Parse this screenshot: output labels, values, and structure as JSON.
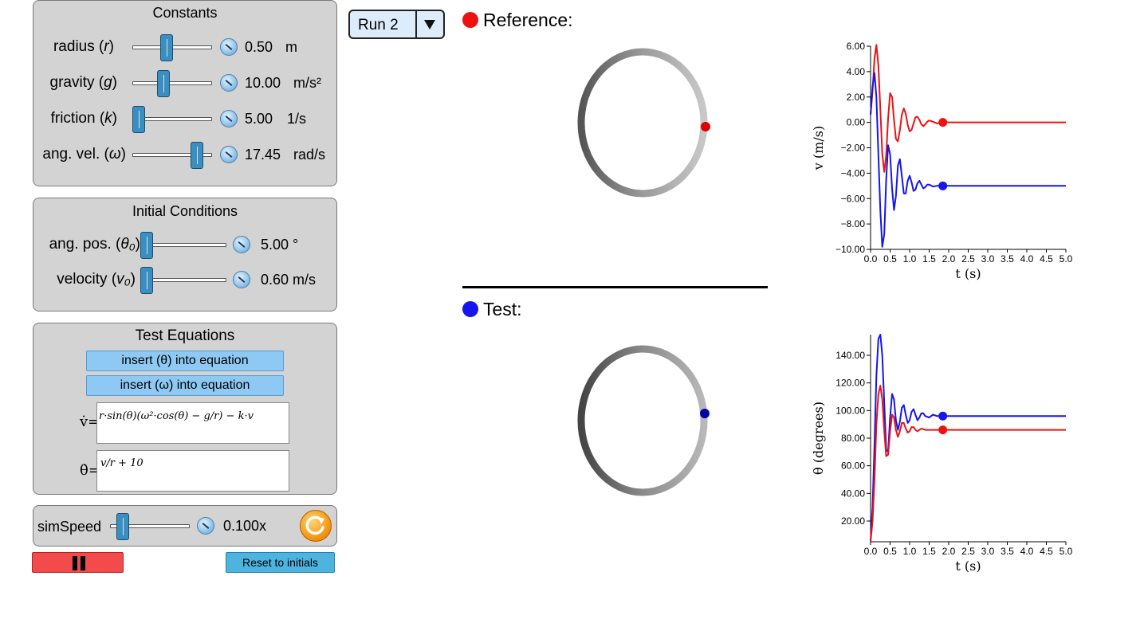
{
  "constants": {
    "title": "Constants",
    "rows": [
      {
        "label": "radius (",
        "sym": "r",
        "close": ")",
        "value": "0.50",
        "unit": "m",
        "level": 0.42
      },
      {
        "label": "gravity (",
        "sym": "g",
        "close": ")",
        "value": "10.00",
        "unit": "m/s²",
        "level": 0.37
      },
      {
        "label": "friction (",
        "sym": "k",
        "close": ")",
        "value": "5.00",
        "unit": "1/s",
        "level": 0.0
      },
      {
        "label": "ang. vel. (",
        "sym": "ω",
        "close": ")",
        "value": "17.45",
        "unit": "rad/s",
        "level": 0.87
      }
    ]
  },
  "initial": {
    "title": "Initial Conditions",
    "rows": [
      {
        "label": "ang. pos. (",
        "sym": "θ₀",
        "close": ")",
        "value": "5.00 °",
        "level": 0.0
      },
      {
        "label": "velocity (",
        "sym": "v₀",
        "close": ")",
        "value": "0.60 m/s",
        "level": 0.0
      }
    ]
  },
  "test_equations": {
    "title": "Test Equations",
    "insert_theta": "insert (θ) into equation",
    "insert_omega": "insert (ω) into equation",
    "vdot_label": "v̇=",
    "thetadot_label": "θ̇=",
    "vdot_eq": "r·sin(θ)(ω²·cos(θ) − g/r) − k·v",
    "thetadot_eq": "v/r + 10"
  },
  "sim": {
    "label": "simSpeed",
    "value": "0.100x",
    "level": 0.1,
    "reset_label": "Reset to initials",
    "pause_icon": "pause-icon",
    "refresh_icon": "refresh-icon"
  },
  "run_select": {
    "selected": "Run 2"
  },
  "reference": {
    "title": "Reference:",
    "color": "#ee1111"
  },
  "test": {
    "title": "Test:",
    "color": "#1515ee"
  },
  "chart_data": [
    {
      "type": "line",
      "xlabel": "t (s)",
      "ylabel": "v (m/s)",
      "xlim": [
        0,
        5
      ],
      "ylim": [
        -10,
        6
      ],
      "xticks": [
        "0.0",
        "0.5",
        "1.0",
        "1.5",
        "2.0",
        "2.5",
        "3.0",
        "3.5",
        "4.0",
        "4.5",
        "5.0"
      ],
      "yticks": [
        "6.00",
        "4.00",
        "2.00",
        "0.00",
        "−2.00",
        "−4.00",
        "−6.00",
        "−8.00",
        "−10.00"
      ],
      "series": [
        {
          "color": "#ee1111",
          "marker": {
            "x": 1.85,
            "y": 0.0
          },
          "x": [
            0,
            0.05,
            0.1,
            0.15,
            0.2,
            0.25,
            0.3,
            0.35,
            0.4,
            0.45,
            0.5,
            0.55,
            0.6,
            0.65,
            0.7,
            0.75,
            0.8,
            0.85,
            0.9,
            0.95,
            1.0,
            1.05,
            1.1,
            1.15,
            1.2,
            1.25,
            1.3,
            1.35,
            1.4,
            1.45,
            1.5,
            1.6,
            1.7,
            1.8,
            1.9,
            2.0,
            2.2,
            2.5,
            3.0,
            4.0,
            5.0
          ],
          "y": [
            0.6,
            2.5,
            5.0,
            6.1,
            4.5,
            1.0,
            -2.5,
            -3.9,
            -2.6,
            0.3,
            2.3,
            2.0,
            0.2,
            -1.3,
            -1.5,
            -0.6,
            0.6,
            1.1,
            0.7,
            -0.2,
            -0.7,
            -0.6,
            -0.1,
            0.4,
            0.45,
            0.2,
            -0.15,
            -0.3,
            -0.15,
            0.05,
            0.15,
            0.05,
            -0.08,
            -0.02,
            0.04,
            0.0,
            0.0,
            0.0,
            0.0,
            0.0,
            0.0
          ]
        },
        {
          "color": "#1515ee",
          "marker": {
            "x": 1.85,
            "y": -5.0
          },
          "x": [
            0,
            0.05,
            0.1,
            0.15,
            0.2,
            0.25,
            0.3,
            0.35,
            0.4,
            0.45,
            0.5,
            0.55,
            0.6,
            0.65,
            0.7,
            0.75,
            0.8,
            0.85,
            0.9,
            0.95,
            1.0,
            1.05,
            1.1,
            1.15,
            1.2,
            1.25,
            1.3,
            1.35,
            1.4,
            1.45,
            1.5,
            1.6,
            1.7,
            1.8,
            1.9,
            2.0,
            2.2,
            2.5,
            3.0,
            4.0,
            5.0
          ],
          "y": [
            0.6,
            2.8,
            3.9,
            2.0,
            -2.5,
            -7.0,
            -9.8,
            -8.8,
            -4.5,
            -1.8,
            -2.5,
            -5.2,
            -6.9,
            -5.8,
            -3.4,
            -2.9,
            -4.2,
            -5.6,
            -5.6,
            -4.6,
            -4.2,
            -4.7,
            -5.4,
            -5.3,
            -4.8,
            -4.6,
            -4.9,
            -5.2,
            -5.1,
            -4.9,
            -4.9,
            -5.05,
            -5.0,
            -4.97,
            -5.0,
            -5.0,
            -5.0,
            -5.0,
            -5.0,
            -5.0,
            -5.0
          ]
        }
      ]
    },
    {
      "type": "line",
      "xlabel": "t (s)",
      "ylabel": "θ (degrees)",
      "xlim": [
        0,
        5
      ],
      "ylim": [
        5,
        155
      ],
      "xticks": [
        "0.0",
        "0.5",
        "1.0",
        "1.5",
        "2.0",
        "2.5",
        "3.0",
        "3.5",
        "4.0",
        "4.5",
        "5.0"
      ],
      "yticks": [
        "140.00",
        "120.00",
        "100.00",
        "80.00",
        "60.00",
        "40.00",
        "20.00"
      ],
      "series": [
        {
          "color": "#1515ee",
          "marker": {
            "x": 1.85,
            "y": 96
          },
          "x": [
            0,
            0.05,
            0.1,
            0.15,
            0.2,
            0.25,
            0.3,
            0.35,
            0.4,
            0.45,
            0.5,
            0.55,
            0.6,
            0.65,
            0.7,
            0.75,
            0.8,
            0.85,
            0.9,
            0.95,
            1.0,
            1.05,
            1.1,
            1.15,
            1.2,
            1.25,
            1.3,
            1.35,
            1.4,
            1.5,
            1.6,
            1.7,
            1.8,
            2.0,
            2.5,
            3.0,
            4.0,
            5.0
          ],
          "y": [
            5,
            30,
            75,
            125,
            152,
            155,
            140,
            105,
            72,
            70,
            95,
            112,
            108,
            93,
            86,
            92,
            102,
            104,
            97,
            91,
            93,
            99,
            101,
            97,
            93,
            95,
            98,
            98,
            96,
            95,
            97,
            96,
            96,
            96,
            96,
            96,
            96,
            96
          ]
        },
        {
          "color": "#ee1111",
          "marker": {
            "x": 1.85,
            "y": 86
          },
          "x": [
            0,
            0.05,
            0.1,
            0.15,
            0.2,
            0.25,
            0.3,
            0.35,
            0.4,
            0.45,
            0.5,
            0.55,
            0.6,
            0.65,
            0.7,
            0.75,
            0.8,
            0.85,
            0.9,
            0.95,
            1.0,
            1.05,
            1.1,
            1.15,
            1.2,
            1.25,
            1.3,
            1.4,
            1.5,
            1.6,
            1.7,
            1.8,
            2.0,
            2.5,
            3.0,
            4.0,
            5.0
          ],
          "y": [
            5,
            20,
            50,
            90,
            112,
            118,
            108,
            85,
            67,
            68,
            85,
            97,
            95,
            86,
            81,
            85,
            91,
            91,
            87,
            84,
            85,
            88,
            88,
            86,
            85,
            86,
            87,
            86,
            86,
            86,
            86,
            86,
            86,
            86,
            86,
            86,
            86
          ]
        }
      ]
    }
  ]
}
